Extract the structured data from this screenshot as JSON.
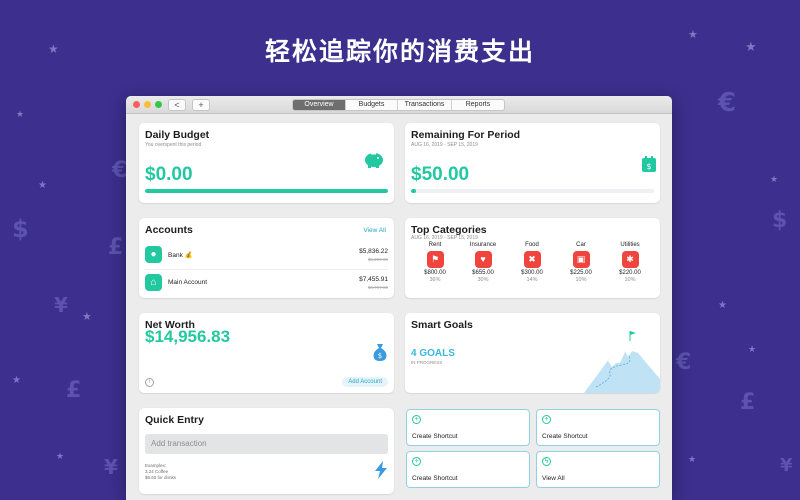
{
  "banner": {
    "headline": "轻松追踪你的消费支出"
  },
  "toolbar": {
    "back_label": "<",
    "add_label": "+",
    "tabs": [
      {
        "label": "Overview",
        "active": true
      },
      {
        "label": "Budgets",
        "active": false
      },
      {
        "label": "Transactions",
        "active": false
      },
      {
        "label": "Reports",
        "active": false
      }
    ]
  },
  "daily_budget": {
    "title": "Daily Budget",
    "subtitle": "You overspent this period",
    "amount": "$0.00",
    "progress": 1.0
  },
  "remaining": {
    "title": "Remaining For Period",
    "date_range": "AUG 16, 2019 - SEP 15, 2019",
    "amount": "$50.00",
    "progress": 0.02
  },
  "accounts": {
    "title": "Accounts",
    "view_all": "View All",
    "items": [
      {
        "name": "Bank 💰",
        "amount": "$5,836.22",
        "previous": "$5,250.00",
        "icon": "piggy-bank-icon"
      },
      {
        "name": "Main Account",
        "amount": "$7,455.91",
        "previous": "$6,707.00",
        "icon": "bank-building-icon"
      }
    ]
  },
  "top_categories": {
    "title": "Top Categories",
    "date_range": "AUG 16, 2019 - SEP 15, 2019",
    "items": [
      {
        "name": "Rent",
        "amount": "$800.00",
        "pct": "36%",
        "icon": "signpost-icon",
        "glyph": "⚑"
      },
      {
        "name": "Insurance",
        "amount": "$655.00",
        "pct": "30%",
        "icon": "heart-pulse-icon",
        "glyph": "♥"
      },
      {
        "name": "Food",
        "amount": "$300.00",
        "pct": "14%",
        "icon": "utensils-icon",
        "glyph": "✖"
      },
      {
        "name": "Car",
        "amount": "$225.00",
        "pct": "10%",
        "icon": "car-icon",
        "glyph": "▣"
      },
      {
        "name": "Utilities",
        "amount": "$220.00",
        "pct": "10%",
        "icon": "lightbulb-icon",
        "glyph": "✱"
      }
    ]
  },
  "net_worth": {
    "title": "Net Worth",
    "amount": "$14,956.83",
    "info": "i",
    "add_account": "Add Account"
  },
  "smart_goals": {
    "title": "Smart Goals",
    "count": "4 GOALS",
    "status": "IN PROGRESS"
  },
  "quick_entry": {
    "title": "Quick Entry",
    "placeholder": "Add transaction",
    "examples_title": "Examples:",
    "example_1": "3.24 Coffee",
    "example_2": "$6.60 for drinks"
  },
  "shortcuts": [
    {
      "label": "Create Shortcut",
      "icon": "plus-circle-icon",
      "glyph": "+"
    },
    {
      "label": "Create Shortcut",
      "icon": "plus-circle-icon",
      "glyph": "+"
    },
    {
      "label": "Create Shortcut",
      "icon": "plus-circle-icon",
      "glyph": "+"
    },
    {
      "label": "View All",
      "icon": "lightning-circle-icon",
      "glyph": "ϟ"
    }
  ],
  "colors": {
    "background": "#3c2f8e",
    "accent_green": "#22c9a0",
    "accent_blue": "#22a6c9",
    "category_red": "#f0443f"
  }
}
